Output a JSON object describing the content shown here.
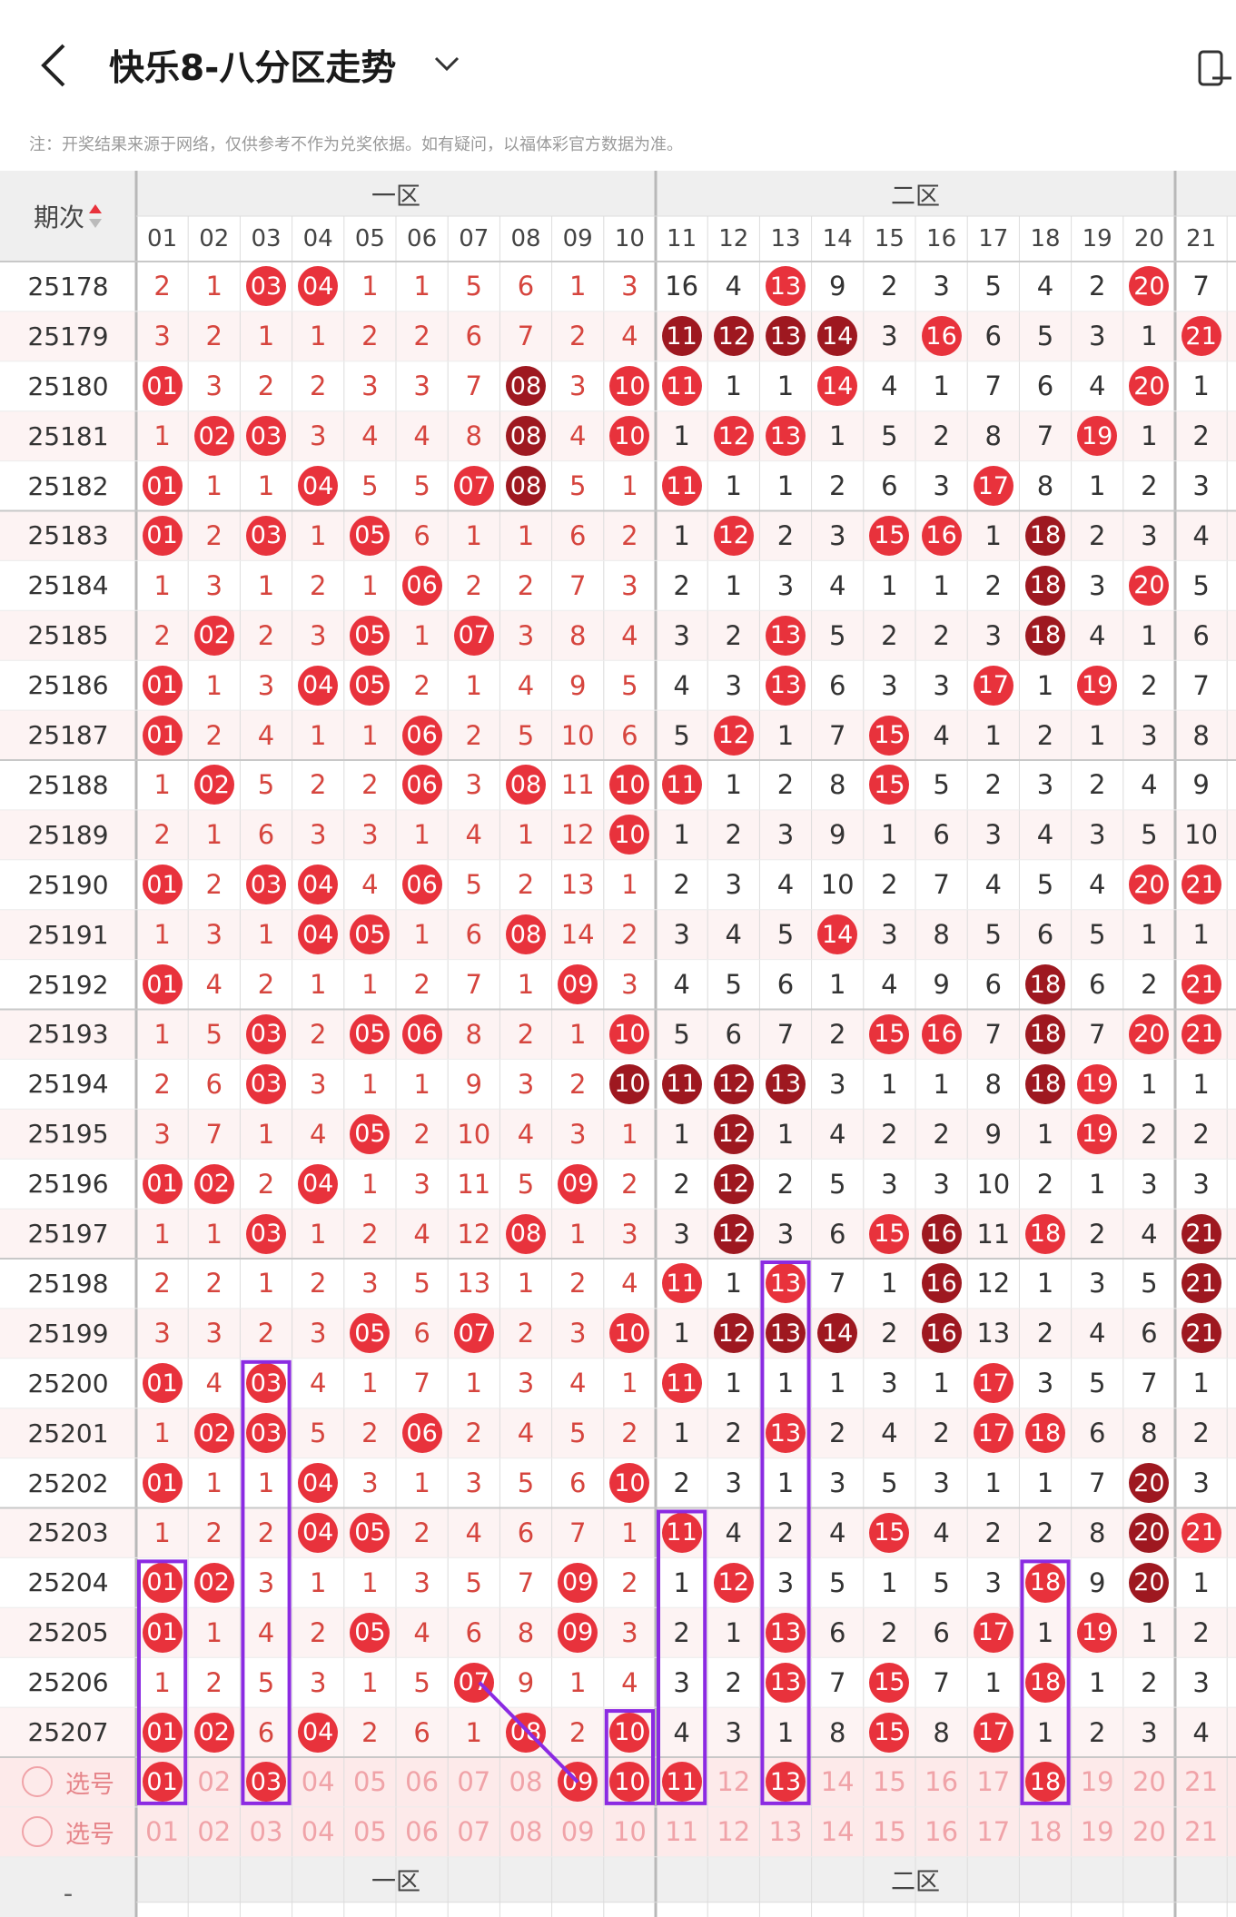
{
  "header": {
    "title": "快乐8-八分区走势",
    "notice": "注：开奖结果来源于网络，仅供参考不作为兑奖依据。如有疑问，以福体彩官方数据为准。"
  },
  "table": {
    "period_header": "期次",
    "zone_labels": [
      "一区",
      "二区"
    ],
    "columns": [
      "01",
      "02",
      "03",
      "04",
      "05",
      "06",
      "07",
      "08",
      "09",
      "10",
      "11",
      "12",
      "13",
      "14",
      "15",
      "16",
      "17",
      "18",
      "19",
      "20",
      "21"
    ],
    "rows": [
      {
        "period": "25178",
        "cells": [
          "2",
          "1",
          "03",
          "04",
          "1",
          "1",
          "5",
          "6",
          "1",
          "3",
          "16",
          "4",
          "13",
          "9",
          "2",
          "3",
          "5",
          "4",
          "2",
          "20",
          "7"
        ],
        "dark": []
      },
      {
        "period": "25179",
        "cells": [
          "3",
          "2",
          "1",
          "1",
          "2",
          "2",
          "6",
          "7",
          "2",
          "4",
          "11",
          "12",
          "13",
          "14",
          "3",
          "16",
          "6",
          "5",
          "3",
          "1",
          "21"
        ],
        "dark": [
          "11",
          "12",
          "13",
          "14"
        ]
      },
      {
        "period": "25180",
        "cells": [
          "01",
          "3",
          "2",
          "2",
          "3",
          "3",
          "7",
          "08",
          "3",
          "10",
          "11",
          "1",
          "1",
          "14",
          "4",
          "1",
          "7",
          "6",
          "4",
          "20",
          "1"
        ],
        "dark": [
          "08"
        ]
      },
      {
        "period": "25181",
        "cells": [
          "1",
          "02",
          "03",
          "3",
          "4",
          "4",
          "8",
          "08",
          "4",
          "10",
          "1",
          "12",
          "13",
          "1",
          "5",
          "2",
          "8",
          "7",
          "19",
          "1",
          "2"
        ],
        "dark": [
          "08"
        ]
      },
      {
        "period": "25182",
        "cells": [
          "01",
          "1",
          "1",
          "04",
          "5",
          "5",
          "07",
          "08",
          "5",
          "1",
          "11",
          "1",
          "1",
          "2",
          "6",
          "3",
          "17",
          "8",
          "1",
          "2",
          "3"
        ],
        "dark": [
          "08"
        ]
      },
      {
        "period": "25183",
        "cells": [
          "01",
          "2",
          "03",
          "1",
          "05",
          "6",
          "1",
          "1",
          "6",
          "2",
          "1",
          "12",
          "2",
          "3",
          "15",
          "16",
          "1",
          "18",
          "2",
          "3",
          "4"
        ],
        "dark": [
          "18"
        ]
      },
      {
        "period": "25184",
        "cells": [
          "1",
          "3",
          "1",
          "2",
          "1",
          "06",
          "2",
          "2",
          "7",
          "3",
          "2",
          "1",
          "3",
          "4",
          "1",
          "1",
          "2",
          "18",
          "3",
          "20",
          "5"
        ],
        "dark": [
          "18"
        ]
      },
      {
        "period": "25185",
        "cells": [
          "2",
          "02",
          "2",
          "3",
          "05",
          "1",
          "07",
          "3",
          "8",
          "4",
          "3",
          "2",
          "13",
          "5",
          "2",
          "2",
          "3",
          "18",
          "4",
          "1",
          "6"
        ],
        "dark": [
          "18"
        ]
      },
      {
        "period": "25186",
        "cells": [
          "01",
          "1",
          "3",
          "04",
          "05",
          "2",
          "1",
          "4",
          "9",
          "5",
          "4",
          "3",
          "13",
          "6",
          "3",
          "3",
          "17",
          "1",
          "19",
          "2",
          "7"
        ],
        "dark": []
      },
      {
        "period": "25187",
        "cells": [
          "01",
          "2",
          "4",
          "1",
          "1",
          "06",
          "2",
          "5",
          "10",
          "6",
          "5",
          "12",
          "1",
          "7",
          "15",
          "4",
          "1",
          "2",
          "1",
          "3",
          "8"
        ],
        "dark": []
      },
      {
        "period": "25188",
        "cells": [
          "1",
          "02",
          "5",
          "2",
          "2",
          "06",
          "3",
          "08",
          "11",
          "10",
          "11",
          "1",
          "2",
          "8",
          "15",
          "5",
          "2",
          "3",
          "2",
          "4",
          "9"
        ],
        "dark": []
      },
      {
        "period": "25189",
        "cells": [
          "2",
          "1",
          "6",
          "3",
          "3",
          "1",
          "4",
          "1",
          "12",
          "10",
          "1",
          "2",
          "3",
          "9",
          "1",
          "6",
          "3",
          "4",
          "3",
          "5",
          "10"
        ],
        "dark": []
      },
      {
        "period": "25190",
        "cells": [
          "01",
          "2",
          "03",
          "04",
          "4",
          "06",
          "5",
          "2",
          "13",
          "1",
          "2",
          "3",
          "4",
          "10",
          "2",
          "7",
          "4",
          "5",
          "4",
          "20",
          "21"
        ],
        "dark": []
      },
      {
        "period": "25191",
        "cells": [
          "1",
          "3",
          "1",
          "04",
          "05",
          "1",
          "6",
          "08",
          "14",
          "2",
          "3",
          "4",
          "5",
          "14",
          "3",
          "8",
          "5",
          "6",
          "5",
          "1",
          "1"
        ],
        "dark": []
      },
      {
        "period": "25192",
        "cells": [
          "01",
          "4",
          "2",
          "1",
          "1",
          "2",
          "7",
          "1",
          "09",
          "3",
          "4",
          "5",
          "6",
          "1",
          "4",
          "9",
          "6",
          "18",
          "6",
          "2",
          "21"
        ],
        "dark": [
          "18"
        ]
      },
      {
        "period": "25193",
        "cells": [
          "1",
          "5",
          "03",
          "2",
          "05",
          "06",
          "8",
          "2",
          "1",
          "10",
          "5",
          "6",
          "7",
          "2",
          "15",
          "16",
          "7",
          "18",
          "7",
          "20",
          "21"
        ],
        "dark": [
          "18"
        ]
      },
      {
        "period": "25194",
        "cells": [
          "2",
          "6",
          "03",
          "3",
          "1",
          "1",
          "9",
          "3",
          "2",
          "10",
          "11",
          "12",
          "13",
          "3",
          "1",
          "1",
          "8",
          "18",
          "19",
          "1",
          "1"
        ],
        "dark": [
          "10",
          "11",
          "12",
          "13",
          "18"
        ]
      },
      {
        "period": "25195",
        "cells": [
          "3",
          "7",
          "1",
          "4",
          "05",
          "2",
          "10",
          "4",
          "3",
          "1",
          "1",
          "12",
          "1",
          "4",
          "2",
          "2",
          "9",
          "1",
          "19",
          "2",
          "2"
        ],
        "dark": [
          "12"
        ]
      },
      {
        "period": "25196",
        "cells": [
          "01",
          "02",
          "2",
          "04",
          "1",
          "3",
          "11",
          "5",
          "09",
          "2",
          "2",
          "12",
          "2",
          "5",
          "3",
          "3",
          "10",
          "2",
          "1",
          "3",
          "3"
        ],
        "dark": [
          "12"
        ]
      },
      {
        "period": "25197",
        "cells": [
          "1",
          "1",
          "03",
          "1",
          "2",
          "4",
          "12",
          "08",
          "1",
          "3",
          "3",
          "12",
          "3",
          "6",
          "15",
          "16",
          "11",
          "18",
          "2",
          "4",
          "21"
        ],
        "dark": [
          "12",
          "16",
          "21"
        ]
      },
      {
        "period": "25198",
        "cells": [
          "2",
          "2",
          "1",
          "2",
          "3",
          "5",
          "13",
          "1",
          "2",
          "4",
          "11",
          "1",
          "13",
          "7",
          "1",
          "16",
          "12",
          "1",
          "3",
          "5",
          "21"
        ],
        "dark": [
          "16",
          "21"
        ]
      },
      {
        "period": "25199",
        "cells": [
          "3",
          "3",
          "2",
          "3",
          "05",
          "6",
          "07",
          "2",
          "3",
          "10",
          "1",
          "12",
          "13",
          "14",
          "2",
          "16",
          "13",
          "2",
          "4",
          "6",
          "21"
        ],
        "dark": [
          "12",
          "13",
          "14",
          "16",
          "21"
        ]
      },
      {
        "period": "25200",
        "cells": [
          "01",
          "4",
          "03",
          "4",
          "1",
          "7",
          "1",
          "3",
          "4",
          "1",
          "11",
          "1",
          "1",
          "1",
          "3",
          "1",
          "17",
          "3",
          "5",
          "7",
          "1"
        ],
        "dark": []
      },
      {
        "period": "25201",
        "cells": [
          "1",
          "02",
          "03",
          "5",
          "2",
          "06",
          "2",
          "4",
          "5",
          "2",
          "1",
          "2",
          "13",
          "2",
          "4",
          "2",
          "17",
          "18",
          "6",
          "8",
          "2"
        ],
        "dark": []
      },
      {
        "period": "25202",
        "cells": [
          "01",
          "1",
          "1",
          "04",
          "3",
          "1",
          "3",
          "5",
          "6",
          "10",
          "2",
          "3",
          "1",
          "3",
          "5",
          "3",
          "1",
          "1",
          "7",
          "20",
          "3"
        ],
        "dark": [
          "20"
        ]
      },
      {
        "period": "25203",
        "cells": [
          "1",
          "2",
          "2",
          "04",
          "05",
          "2",
          "4",
          "6",
          "7",
          "1",
          "11",
          "4",
          "2",
          "4",
          "15",
          "4",
          "2",
          "2",
          "8",
          "20",
          "21"
        ],
        "dark": [
          "20"
        ]
      },
      {
        "period": "25204",
        "cells": [
          "01",
          "02",
          "3",
          "1",
          "1",
          "3",
          "5",
          "7",
          "09",
          "2",
          "1",
          "12",
          "3",
          "5",
          "1",
          "5",
          "3",
          "18",
          "9",
          "20",
          "1"
        ],
        "dark": [
          "20"
        ]
      },
      {
        "period": "25205",
        "cells": [
          "01",
          "1",
          "4",
          "2",
          "05",
          "4",
          "6",
          "8",
          "09",
          "3",
          "2",
          "1",
          "13",
          "6",
          "2",
          "6",
          "17",
          "1",
          "19",
          "1",
          "2"
        ],
        "dark": []
      },
      {
        "period": "25206",
        "cells": [
          "1",
          "2",
          "5",
          "3",
          "1",
          "5",
          "07",
          "9",
          "1",
          "4",
          "3",
          "2",
          "13",
          "7",
          "15",
          "7",
          "1",
          "18",
          "1",
          "2",
          "3"
        ],
        "dark": []
      },
      {
        "period": "25207",
        "cells": [
          "01",
          "02",
          "6",
          "04",
          "2",
          "6",
          "1",
          "08",
          "2",
          "10",
          "4",
          "3",
          "1",
          "8",
          "15",
          "8",
          "17",
          "1",
          "2",
          "3",
          "4"
        ],
        "dark": []
      }
    ],
    "pick_rows": [
      {
        "label": "选号",
        "selected": [
          "01",
          "03",
          "09",
          "10",
          "11",
          "13",
          "18"
        ]
      },
      {
        "label": "选号",
        "selected": []
      }
    ]
  },
  "colors": {
    "accent": "#e8323c",
    "dark_ball": "#9e1820",
    "highlight_box": "#8b2be2",
    "grid": "#dcdcdc",
    "header_bg": "#efefef",
    "pick_text": "#f0a3a8"
  }
}
